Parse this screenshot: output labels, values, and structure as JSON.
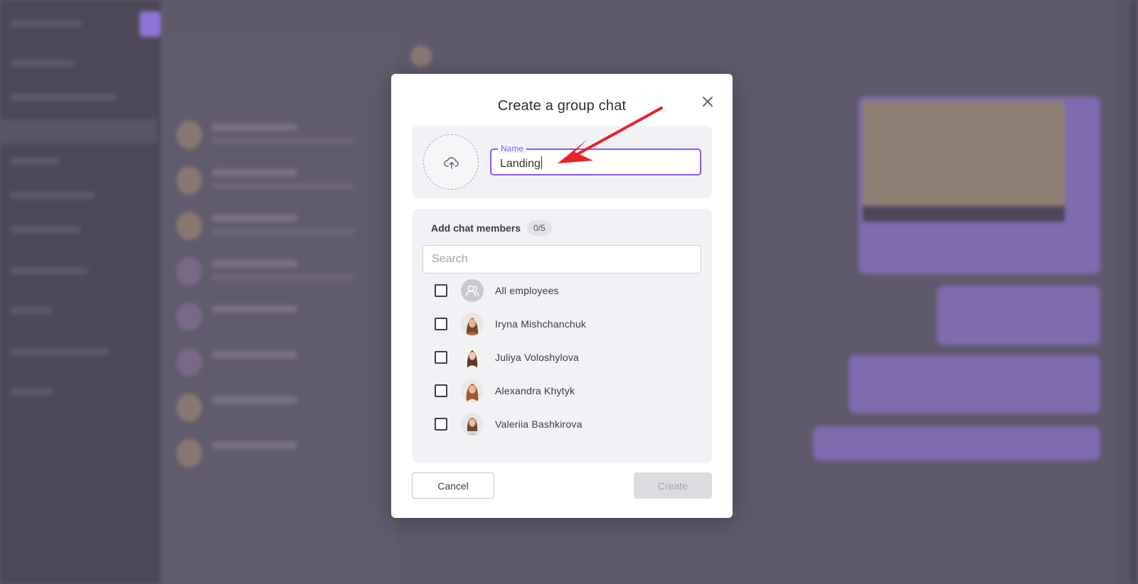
{
  "modal": {
    "title": "Create a group chat",
    "name_label": "Name",
    "name_value": "Landing",
    "members_title": "Add chat members",
    "members_count": "0/5",
    "search_placeholder": "Search",
    "members": [
      {
        "name": "All employees",
        "checked": false,
        "avatar": "group-icon"
      },
      {
        "name": "Iryna Mishchanchuk",
        "checked": false,
        "avatar": "photo"
      },
      {
        "name": "Juliya Voloshylova",
        "checked": false,
        "avatar": "photo"
      },
      {
        "name": "Alexandra Khytyk",
        "checked": false,
        "avatar": "photo"
      },
      {
        "name": "Valeriia Bashkirova",
        "checked": false,
        "avatar": "photo"
      }
    ],
    "cancel_label": "Cancel",
    "create_label": "Create",
    "create_disabled": true
  },
  "colors": {
    "accent": "#8c57f0",
    "annotation_arrow": "#e8232a",
    "overlay": "#5f5a6b"
  },
  "icons": {
    "close": "close-icon",
    "upload": "cloud-upload-icon",
    "group": "group-icon"
  }
}
